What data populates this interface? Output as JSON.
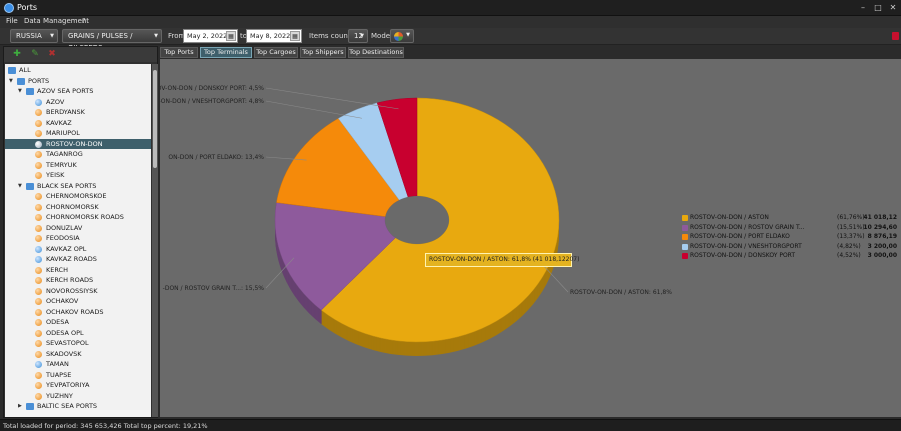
{
  "window": {
    "title": "Ports"
  },
  "menu": {
    "file": "File",
    "data_management": "Data Management",
    "help": "?"
  },
  "toolbar": {
    "country": "RUSSIA",
    "cargo": "GRAINS / PULSES / OILSEEDS",
    "from_label": "From",
    "from_date": "May 2, 2022",
    "to_label": "to",
    "to_date": "May 8, 2022",
    "items_label": "Items count:",
    "items_value": "12",
    "mode_label": "Mode:"
  },
  "tree": [
    {
      "label": "ALL",
      "icon": "folder",
      "expander": "",
      "indent": 1,
      "selected": false
    },
    {
      "label": "PORTS",
      "icon": "folder",
      "expander": "▼",
      "indent": 2,
      "selected": false
    },
    {
      "label": "AZOV SEA PORTS",
      "icon": "folder",
      "expander": "▼",
      "indent": 3,
      "selected": false
    },
    {
      "label": "AZOV",
      "icon": "blue",
      "expander": "",
      "indent": 4,
      "selected": false
    },
    {
      "label": "BERDYANSK",
      "icon": "orange",
      "expander": "",
      "indent": 4,
      "selected": false
    },
    {
      "label": "KAVKAZ",
      "icon": "orange",
      "expander": "",
      "indent": 4,
      "selected": false
    },
    {
      "label": "MARIUPOL",
      "icon": "orange",
      "expander": "",
      "indent": 4,
      "selected": false
    },
    {
      "label": "ROSTOV-ON-DON",
      "icon": "white",
      "expander": "",
      "indent": 4,
      "selected": true
    },
    {
      "label": "TAGANROG",
      "icon": "orange",
      "expander": "",
      "indent": 4,
      "selected": false
    },
    {
      "label": "TEMRYUK",
      "icon": "orange",
      "expander": "",
      "indent": 4,
      "selected": false
    },
    {
      "label": "YEISK",
      "icon": "orange",
      "expander": "",
      "indent": 4,
      "selected": false
    },
    {
      "label": "BLACK SEA PORTS",
      "icon": "folder",
      "expander": "▼",
      "indent": 3,
      "selected": false
    },
    {
      "label": "CHERNOMORSKOE",
      "icon": "orange",
      "expander": "",
      "indent": 4,
      "selected": false
    },
    {
      "label": "CHORNOMORSK",
      "icon": "orange",
      "expander": "",
      "indent": 4,
      "selected": false
    },
    {
      "label": "CHORNOMORSK ROADS",
      "icon": "orange",
      "expander": "",
      "indent": 4,
      "selected": false
    },
    {
      "label": "DONUZLAV",
      "icon": "orange",
      "expander": "",
      "indent": 4,
      "selected": false
    },
    {
      "label": "FEODOSIA",
      "icon": "orange",
      "expander": "",
      "indent": 4,
      "selected": false
    },
    {
      "label": "KAVKAZ OPL",
      "icon": "blue",
      "expander": "",
      "indent": 4,
      "selected": false
    },
    {
      "label": "KAVKAZ ROADS",
      "icon": "blue",
      "expander": "",
      "indent": 4,
      "selected": false
    },
    {
      "label": "KERCH",
      "icon": "orange",
      "expander": "",
      "indent": 4,
      "selected": false
    },
    {
      "label": "KERCH ROADS",
      "icon": "orange",
      "expander": "",
      "indent": 4,
      "selected": false
    },
    {
      "label": "NOVOROSSIYSK",
      "icon": "orange",
      "expander": "",
      "indent": 4,
      "selected": false
    },
    {
      "label": "OCHAKOV",
      "icon": "orange",
      "expander": "",
      "indent": 4,
      "selected": false
    },
    {
      "label": "OCHAKOV ROADS",
      "icon": "orange",
      "expander": "",
      "indent": 4,
      "selected": false
    },
    {
      "label": "ODESA",
      "icon": "orange",
      "expander": "",
      "indent": 4,
      "selected": false
    },
    {
      "label": "ODESA OPL",
      "icon": "orange",
      "expander": "",
      "indent": 4,
      "selected": false
    },
    {
      "label": "SEVASTOPOL",
      "icon": "orange",
      "expander": "",
      "indent": 4,
      "selected": false
    },
    {
      "label": "SKADOVSK",
      "icon": "orange",
      "expander": "",
      "indent": 4,
      "selected": false
    },
    {
      "label": "TAMAN",
      "icon": "blue",
      "expander": "",
      "indent": 4,
      "selected": false
    },
    {
      "label": "TUAPSE",
      "icon": "orange",
      "expander": "",
      "indent": 4,
      "selected": false
    },
    {
      "label": "YEVPATORIYA",
      "icon": "orange",
      "expander": "",
      "indent": 4,
      "selected": false
    },
    {
      "label": "YUZHNY",
      "icon": "orange",
      "expander": "",
      "indent": 4,
      "selected": false
    },
    {
      "label": "BALTIC SEA PORTS",
      "icon": "folder",
      "expander": "▶",
      "indent": 3,
      "selected": false
    }
  ],
  "tabs": [
    {
      "label": "Top Ports",
      "active": false
    },
    {
      "label": "Top Terminals",
      "active": true
    },
    {
      "label": "Top Cargoes",
      "active": false
    },
    {
      "label": "Top Shippers",
      "active": false
    },
    {
      "label": "Top Destinations",
      "active": false
    }
  ],
  "chart_data": {
    "type": "pie",
    "style": "3d-doughnut",
    "slices": [
      {
        "name": "ROSTOV-ON-DON / ASTON",
        "percent": 61.76,
        "value": 41018.12,
        "percent_text": "(61,76%)",
        "value_text": "41 018,12",
        "label": "ROSTOV-ON-DON / ASTON: 61,8%",
        "color": "#e8a90f"
      },
      {
        "name": "ROSTOV-ON-DON / ROSTOV GRAIN T...",
        "percent": 15.51,
        "value": 10294.6,
        "percent_text": "(15,51%)",
        "value_text": "10 294,60",
        "label": "-DON / ROSTOV GRAIN T...: 15,5%",
        "color": "#8e5a9c"
      },
      {
        "name": "ROSTOV-ON-DON / PORT ELDAKO",
        "percent": 13.37,
        "value": 8876.19,
        "percent_text": "(13,37%)",
        "value_text": "8 876,19",
        "label": "ON-DON / PORT ELDAKO: 13,4%",
        "color": "#f58a0a"
      },
      {
        "name": "ROSTOV-ON-DON / VNESHTORGPORT",
        "percent": 4.82,
        "value": 3200.0,
        "percent_text": "(4,82%)",
        "value_text": "3 200,00",
        "label": "/-ON-DON / VNESHTORGPORT: 4,8%",
        "color": "#a6cdf0"
      },
      {
        "name": "ROSTOV-ON-DON / DONSKOY PORT",
        "percent": 4.52,
        "value": 3000.0,
        "percent_text": "(4,52%)",
        "value_text": "3 000,00",
        "label": "OV-ON-DON / DONSKOY PORT: 4,5%",
        "color": "#c8002f"
      }
    ],
    "tooltip": "ROSTOV-ON-DON / ASTON: 61,8% (41 018,12207)",
    "legend_position": "right"
  },
  "status": {
    "text": "Total loaded for period: 345 653,426 Total top percent: 19,21%"
  }
}
